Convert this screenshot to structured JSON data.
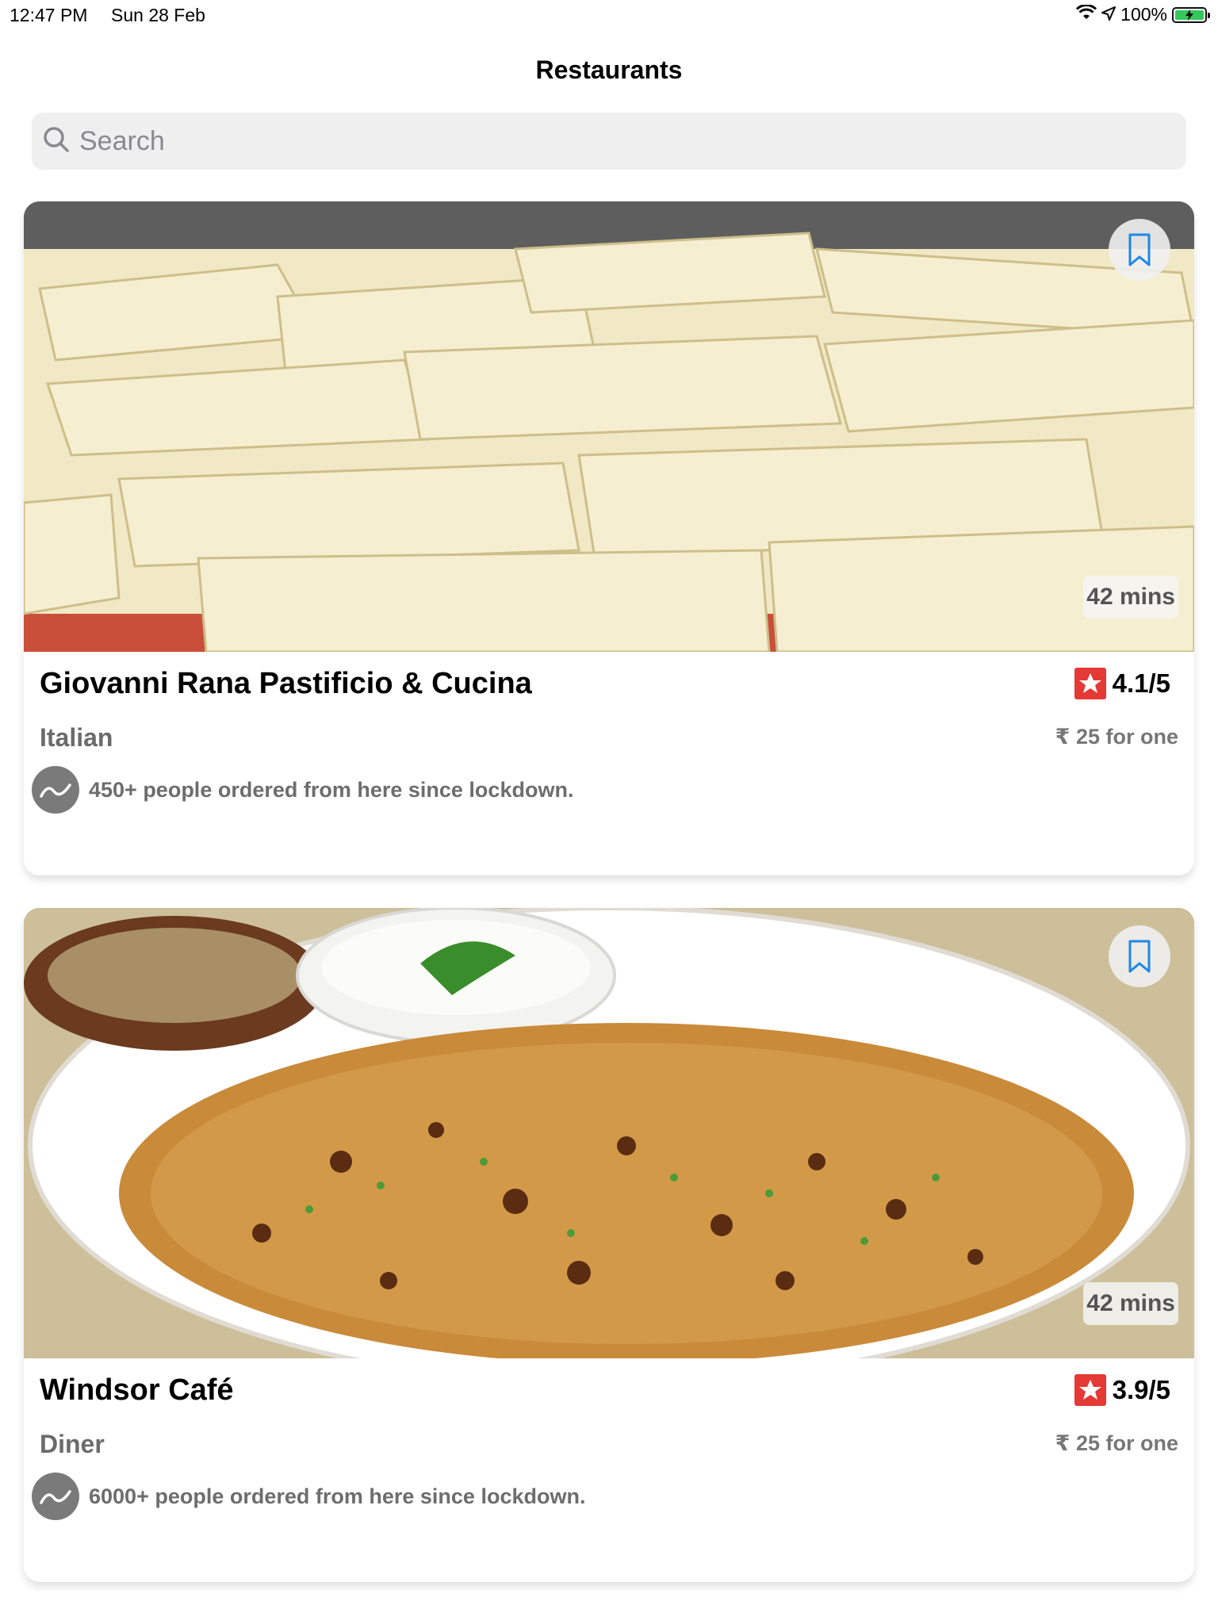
{
  "status_bar": {
    "time": "12:47 PM",
    "date": "Sun 28 Feb",
    "battery": "100%"
  },
  "nav": {
    "title": "Restaurants"
  },
  "search": {
    "placeholder": "Search"
  },
  "restaurants": [
    {
      "name": "Giovanni Rana Pastificio & Cucina",
      "rating": "4.1/5",
      "cuisine": "Italian",
      "price": "₹ 25 for one",
      "eta": "42 mins",
      "orders_note": "450+ people ordered from here since lockdown.",
      "image": "paneer-barfi"
    },
    {
      "name": "Windsor Café",
      "rating": "3.9/5",
      "cuisine": "Diner",
      "price": "₹ 25 for one",
      "eta": "42 mins",
      "orders_note": "6000+ people ordered from here since lockdown.",
      "image": "paratha-plate"
    }
  ],
  "colors": {
    "rating_badge": "#e53935",
    "bookmark": "#1e88e5",
    "search_bg": "#efeff0"
  },
  "icons": {
    "search": "search-icon",
    "bookmark": "bookmark-icon",
    "star": "star-icon",
    "trend": "trend-icon",
    "wifi": "wifi-icon",
    "location": "location-arrow-icon",
    "battery": "battery-icon"
  }
}
